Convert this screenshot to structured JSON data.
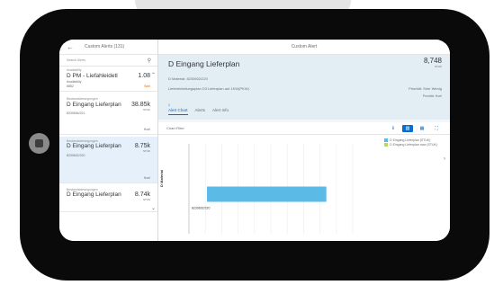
{
  "master": {
    "title": "Custom Alerts (131)",
    "search_placeholder": "Search Alerts",
    "groups": [
      {
        "label": "Availability",
        "items": [
          {
            "title": "D PM - Liefahleidetl",
            "value": "1.08",
            "unit": "",
            "sub1": "Availability",
            "sub2": "8882",
            "tag": "Wait",
            "tag_color": "orange"
          }
        ]
      },
      {
        "label": "Bestandsbewegungen",
        "items": [
          {
            "title": "D Eingang Lieferplan",
            "value": "38.85k",
            "unit": "STUK",
            "sub1": "8230694/221",
            "sub2": "",
            "tag": "Hoel",
            "tag_color": "gray"
          }
        ]
      },
      {
        "label": "Bestandsbewegungen",
        "items": [
          {
            "title": "D Eingang Lieferplan",
            "value": "8.75k",
            "unit": "STUK",
            "sub1": "8230602/220",
            "sub2": "",
            "tag": "Hoel",
            "tag_color": "gray",
            "selected": true
          }
        ]
      },
      {
        "label": "Bestandsbewegungen",
        "items": [
          {
            "title": "D Eingang Lieferplan",
            "value": "8.74k",
            "unit": "STUK",
            "sub1": "",
            "sub2": "",
            "tag": "",
            "tag_color": "gray"
          }
        ]
      }
    ]
  },
  "detail": {
    "top_title": "Custom Alert",
    "header": {
      "title": "D Eingang Lieferplan",
      "number": "8,748",
      "unit": "STUK",
      "attr1": "D Material: 8230602/220",
      "attr2": "Liefereinteilungsplan D3 Lieferplan auf 1KW(PKW)",
      "attr_right": "Priorität: Sehr Wenig",
      "attr_right2": "Priorität: Hoel",
      "tab_count": "1"
    },
    "tabs": [
      "Alert Chart",
      "Alerts",
      "Alert Info"
    ],
    "chart_toolbar": {
      "left_label": "Chart Filter",
      "buttons": [
        "i",
        "chart",
        "list",
        "full"
      ]
    }
  },
  "chart_data": {
    "type": "bar",
    "orientation": "horizontal",
    "categories": [
      "8230602/220"
    ],
    "series": [
      {
        "name": "D Eingang Lieferplan (STUK)",
        "values": [
          8748
        ],
        "color": "#5cbae6"
      },
      {
        "name": "D Eingang Lieferplan max (STUK)",
        "values": [
          0
        ],
        "color": "#b6d957"
      }
    ],
    "ylabel": "D Material",
    "xlim": [
      0,
      12000
    ],
    "grid": true,
    "legend": "top-right"
  }
}
